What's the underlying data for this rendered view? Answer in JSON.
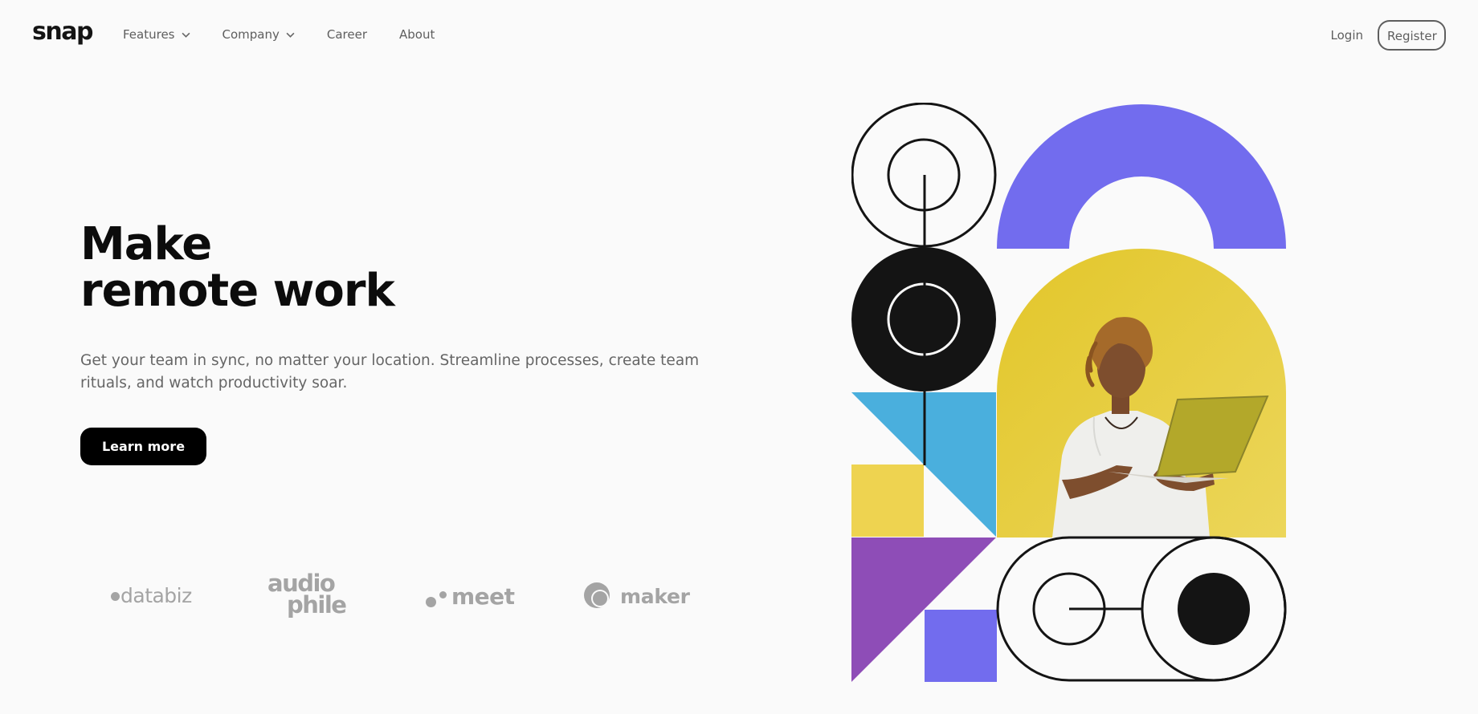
{
  "brand": {
    "logo": "snap"
  },
  "nav": {
    "items": [
      {
        "label": "Features",
        "has_dropdown": true
      },
      {
        "label": "Company",
        "has_dropdown": true
      },
      {
        "label": "Career",
        "has_dropdown": false
      },
      {
        "label": "About",
        "has_dropdown": false
      }
    ],
    "login_label": "Login",
    "register_label": "Register"
  },
  "hero": {
    "title_line1": "Make",
    "title_line2": "remote work",
    "description": "Get your team in sync, no matter your location. Streamline processes, create team rituals, and watch productivity soar.",
    "cta_label": "Learn more"
  },
  "clients": {
    "databiz": "databiz",
    "audiophile_line1": "audio",
    "audiophile_line2": "phile",
    "meet": "meet",
    "maker": "maker"
  },
  "colors": {
    "background": "#fafafa",
    "text_dark": "#141414",
    "text_muted": "#666666",
    "purple": "#726cee",
    "violet": "#8e4db7",
    "blue": "#4aafdd",
    "yellow": "#eed350",
    "hero_photo_bg": "#e6cc35"
  },
  "icons": [
    "chevron-down-icon",
    "databiz-logo",
    "audiophile-logo",
    "meet-logo",
    "maker-logo"
  ]
}
